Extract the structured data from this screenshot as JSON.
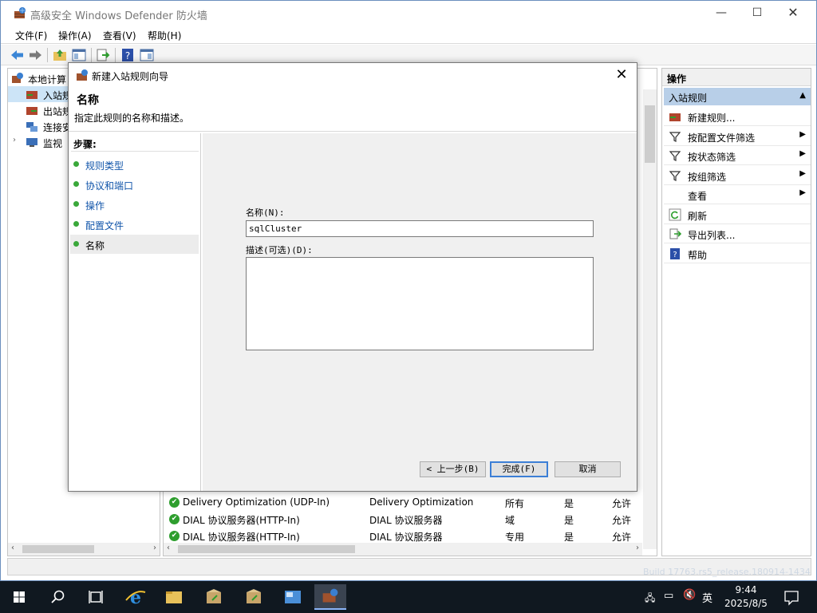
{
  "window": {
    "title": "高级安全 Windows Defender 防火墙",
    "min_glyph": "—",
    "max_glyph": "☐",
    "close_glyph": "✕"
  },
  "menu": [
    "文件(F)",
    "操作(A)",
    "查看(V)",
    "帮助(H)"
  ],
  "tree": {
    "root": "本地计算",
    "items": [
      "入站规",
      "出站规",
      "连接安",
      "监视"
    ]
  },
  "rules": [
    {
      "name": "Delivery Optimization (UDP-In)",
      "group": "Delivery Optimization",
      "profile": "所有",
      "enabled": "是",
      "action": "允许"
    },
    {
      "name": "DIAL 协议服务器(HTTP-In)",
      "group": "DIAL 协议服务器",
      "profile": "域",
      "enabled": "是",
      "action": "允许"
    },
    {
      "name": "DIAL 协议服务器(HTTP-In)",
      "group": "DIAL 协议服务器",
      "profile": "专用",
      "enabled": "是",
      "action": "允许"
    }
  ],
  "actions": {
    "header": "操作",
    "section": "入站规则",
    "items": [
      {
        "label": "新建规则...",
        "icon": "new-rule-icon",
        "submenu": false
      },
      {
        "label": "按配置文件筛选",
        "icon": "filter-icon",
        "submenu": true
      },
      {
        "label": "按状态筛选",
        "icon": "filter-icon",
        "submenu": true
      },
      {
        "label": "按组筛选",
        "icon": "filter-icon",
        "submenu": true
      },
      {
        "label": "查看",
        "icon": "",
        "submenu": true
      },
      {
        "label": "刷新",
        "icon": "refresh-icon",
        "submenu": false
      },
      {
        "label": "导出列表...",
        "icon": "export-icon",
        "submenu": false
      },
      {
        "label": "帮助",
        "icon": "help-icon",
        "submenu": false
      }
    ]
  },
  "dialog": {
    "title": "新建入站规则向导",
    "heading": "名称",
    "subheading": "指定此规则的名称和描述。",
    "steps_header": "步骤:",
    "steps": [
      "规则类型",
      "协议和端口",
      "操作",
      "配置文件",
      "名称"
    ],
    "current_step": 4,
    "name_label": "名称(N):",
    "name_value": "sqlCluster",
    "desc_label": "描述(可选)(D):",
    "desc_value": "",
    "back_button": "< 上一步(B)",
    "finish_button": "完成(F)",
    "cancel_button": "取消"
  },
  "taskbar": {
    "ime": "英",
    "time": "9:44",
    "date": "2025/8/5",
    "build_text": "Build 17763.rs5_release.180914-1434"
  },
  "colors": {
    "accent": "#3c7fd6",
    "step_dot": "#3aa83a",
    "step_link": "#1155aa",
    "selection": "#cce4f7",
    "action_section": "#b8cfe8",
    "taskbar": "#101820"
  }
}
